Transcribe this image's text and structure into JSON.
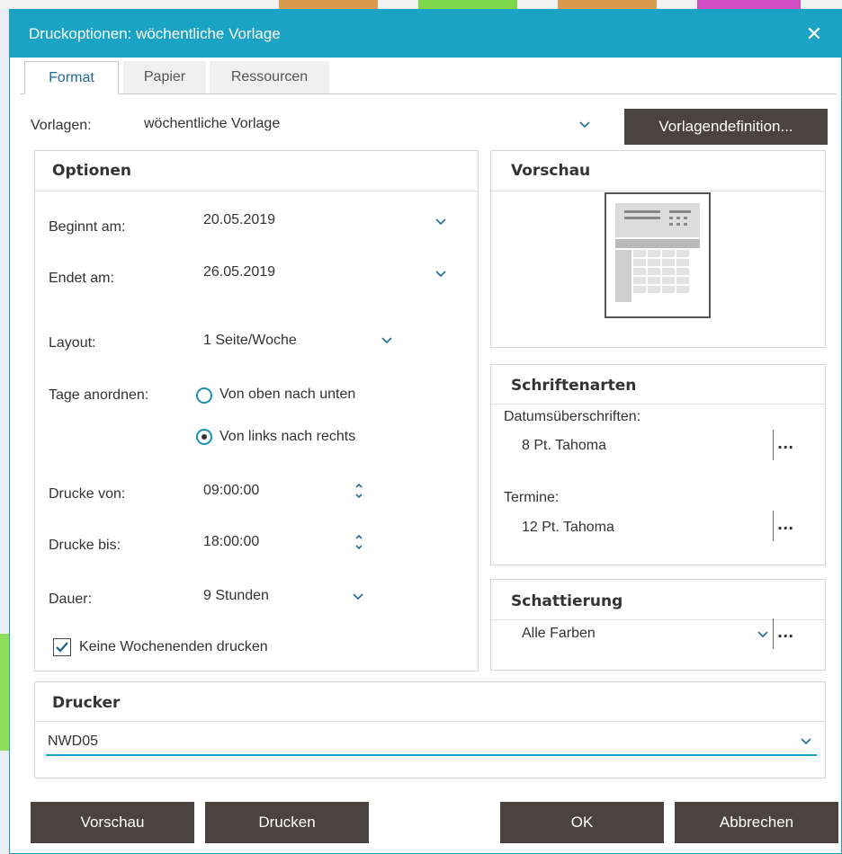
{
  "window": {
    "title": "Druckoptionen: wöchentliche Vorlage",
    "close_icon": "close-icon"
  },
  "colors": {
    "accent": "#1aa3c4",
    "button_dark": "#4a4340",
    "tab_active_text": "#1e6c96"
  },
  "tabs": [
    {
      "label": "Format",
      "active": true
    },
    {
      "label": "Papier",
      "active": false
    },
    {
      "label": "Ressourcen",
      "active": false
    }
  ],
  "template": {
    "label": "Vorlagen:",
    "value": "wöchentliche Vorlage",
    "definition_button": "Vorlagendefinition..."
  },
  "options": {
    "heading": "Optionen",
    "start_label": "Beginnt am:",
    "start_value": "20.05.2019",
    "end_label": "Endet am:",
    "end_value": "26.05.2019",
    "layout_label": "Layout:",
    "layout_value": "1 Seite/Woche",
    "arrange_label": "Tage anordnen:",
    "arrange_options": [
      {
        "label": "Von oben nach unten",
        "selected": false
      },
      {
        "label": "Von links nach rechts",
        "selected": true
      }
    ],
    "print_from_label": "Drucke von:",
    "print_from_value": "09:00:00",
    "print_to_label": "Drucke bis:",
    "print_to_value": "18:00:00",
    "duration_label": "Dauer:",
    "duration_value": "9 Stunden",
    "no_weekends_label": "Keine Wochenenden drucken",
    "no_weekends_checked": true
  },
  "preview": {
    "heading": "Vorschau"
  },
  "fonts": {
    "heading": "Schriftenarten",
    "date_headings_label": "Datumsüberschriften:",
    "date_headings_value": "8 Pt. Tahoma",
    "appointments_label": "Termine:",
    "appointments_value": "12 Pt. Tahoma",
    "more": "..."
  },
  "shading": {
    "heading": "Schattierung",
    "value": "Alle Farben",
    "more": "..."
  },
  "printer": {
    "heading": "Drucker",
    "value": "NWD05"
  },
  "footer": {
    "preview_button": "Vorschau",
    "print_button": "Drucken",
    "ok_button": "OK",
    "cancel_button": "Abbrechen"
  }
}
